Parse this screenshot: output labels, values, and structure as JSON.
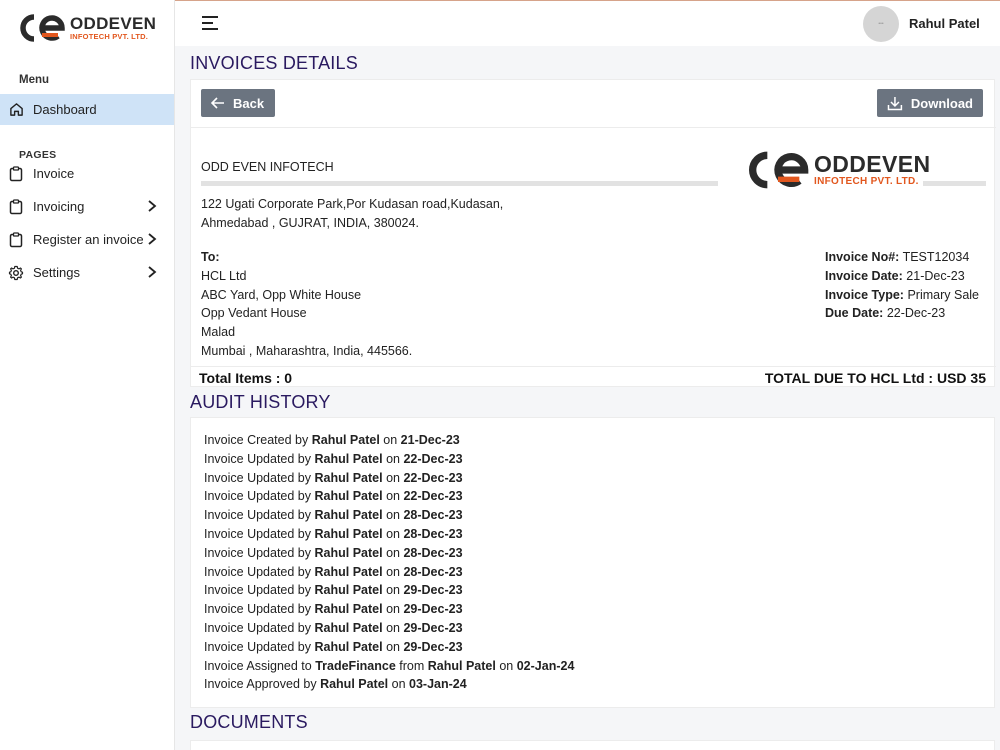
{
  "brand": {
    "name": "ODDEVEN",
    "sub": "INFOTECH PVT. LTD."
  },
  "sidebar": {
    "menu_heading": "Menu",
    "dashboard": "Dashboard",
    "pages_heading": "PAGES",
    "items": [
      {
        "label": "Invoice",
        "icon": "clipboard-icon",
        "chevron": false
      },
      {
        "label": "Invoicing",
        "icon": "clipboard-icon",
        "chevron": true
      },
      {
        "label": "Register an invoice",
        "icon": "clipboard-icon",
        "chevron": true
      },
      {
        "label": "Settings",
        "icon": "gear-icon",
        "chevron": true
      }
    ]
  },
  "topbar": {
    "user_name": "Rahul Patel"
  },
  "invoice": {
    "title": "INVOICES DETAILS",
    "back_label": "Back",
    "download_label": "Download",
    "company": "ODD EVEN INFOTECH",
    "address_line1": "122 Ugati Corporate Park,Por Kudasan road,Kudasan,",
    "address_line2": "Ahmedabad , GUJRAT, INDIA, 380024.",
    "to_label": "To:",
    "to_lines": [
      "HCL Ltd",
      "ABC Yard, Opp White House",
      "Opp Vedant House",
      "Malad",
      "Mumbai , Maharashtra, India, 445566."
    ],
    "meta": [
      {
        "label": "Invoice No#:",
        "value": "TEST12034"
      },
      {
        "label": "Invoice Date:",
        "value": "21-Dec-23"
      },
      {
        "label": "Invoice Type:",
        "value": "Primary Sale"
      },
      {
        "label": "Due Date:",
        "value": "22-Dec-23"
      }
    ],
    "total_items": "Total Items : 0",
    "total_due": "TOTAL DUE TO HCL Ltd : USD 35"
  },
  "audit": {
    "title": "AUDIT HISTORY",
    "entries": [
      {
        "action": "Invoice Created by",
        "user": "Rahul Patel",
        "on": "on",
        "date": "21-Dec-23"
      },
      {
        "action": "Invoice Updated by",
        "user": "Rahul Patel",
        "on": "on",
        "date": "22-Dec-23"
      },
      {
        "action": "Invoice Updated by",
        "user": "Rahul Patel",
        "on": "on",
        "date": "22-Dec-23"
      },
      {
        "action": "Invoice Updated by",
        "user": "Rahul Patel",
        "on": "on",
        "date": "22-Dec-23"
      },
      {
        "action": "Invoice Updated by",
        "user": "Rahul Patel",
        "on": "on",
        "date": "28-Dec-23"
      },
      {
        "action": "Invoice Updated by",
        "user": "Rahul Patel",
        "on": "on",
        "date": "28-Dec-23"
      },
      {
        "action": "Invoice Updated by",
        "user": "Rahul Patel",
        "on": "on",
        "date": "28-Dec-23"
      },
      {
        "action": "Invoice Updated by",
        "user": "Rahul Patel",
        "on": "on",
        "date": "28-Dec-23"
      },
      {
        "action": "Invoice Updated by",
        "user": "Rahul Patel",
        "on": "on",
        "date": "29-Dec-23"
      },
      {
        "action": "Invoice Updated by",
        "user": "Rahul Patel",
        "on": "on",
        "date": "29-Dec-23"
      },
      {
        "action": "Invoice Updated by",
        "user": "Rahul Patel",
        "on": "on",
        "date": "29-Dec-23"
      },
      {
        "action": "Invoice Updated by",
        "user": "Rahul Patel",
        "on": "on",
        "date": "29-Dec-23"
      }
    ],
    "assigned": {
      "action": "Invoice Assigned to",
      "target": "TradeFinance",
      "from": "from",
      "user": "Rahul Patel",
      "on": "on",
      "date": "02-Jan-24"
    },
    "approved": {
      "action": "Invoice Approved by",
      "user": "Rahul Patel",
      "on": "on",
      "date": "03-Jan-24"
    }
  },
  "documents": {
    "title": "DOCUMENTS"
  },
  "colors": {
    "accent_orange": "#e2571e",
    "title_purple": "#2a1a60",
    "active_nav": "#cfe3f7",
    "button_gray": "#6b7480"
  }
}
